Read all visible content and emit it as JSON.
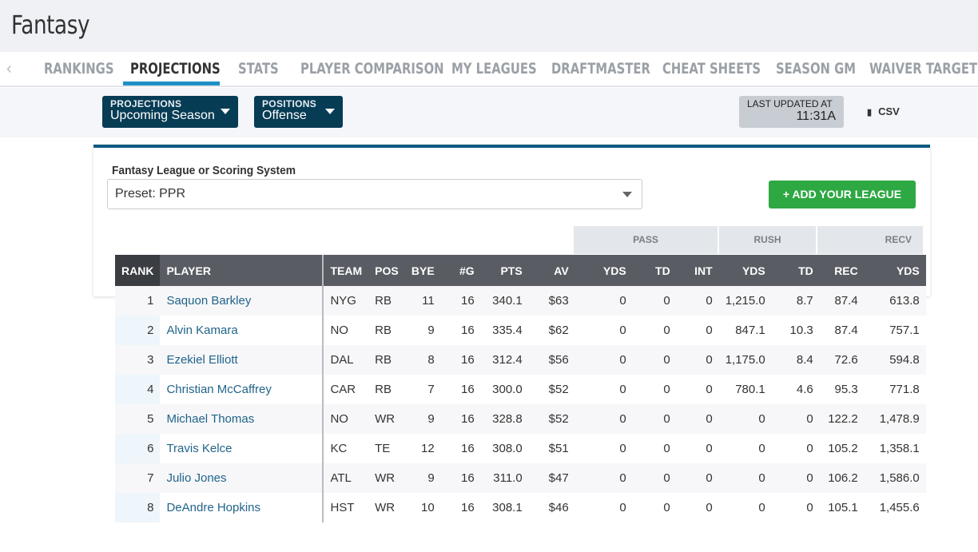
{
  "app": {
    "title": "Fantasy"
  },
  "nav": {
    "tabs": [
      "RANKINGS",
      "PROJECTIONS",
      "STATS",
      "PLAYER COMPARISON",
      "MY LEAGUES",
      "DRAFTMASTER",
      "CHEAT SHEETS",
      "SEASON GM",
      "WAIVER TARGETS"
    ],
    "active": "PROJECTIONS"
  },
  "filters": {
    "projections_label": "PROJECTIONS",
    "projections_value": "Upcoming Season",
    "positions_label": "POSITIONS",
    "positions_value": "Offense"
  },
  "updated": {
    "label": "LAST UPDATED AT",
    "time": "11:31A"
  },
  "csv_label": "CSV",
  "league": {
    "label": "Fantasy League or Scoring System",
    "value": "Preset: PPR",
    "add_label": "+ ADD YOUR LEAGUE"
  },
  "colors": {
    "accent": "#1e90c6",
    "dropdown": "#073c55",
    "add": "#2ea843",
    "header": "#595d63"
  },
  "table": {
    "groups": [
      "PASS",
      "RUSH",
      "RECV"
    ],
    "columns": [
      "RANK",
      "PLAYER",
      "TEAM",
      "POS",
      "BYE",
      "#G",
      "PTS",
      "AV",
      "YDS",
      "TD",
      "INT",
      "YDS",
      "TD",
      "REC",
      "YDS"
    ],
    "rows": [
      [
        "1",
        "Saquon Barkley",
        "NYG",
        "RB",
        "11",
        "16",
        "340.1",
        "$63",
        "0",
        "0",
        "0",
        "1,215.0",
        "8.7",
        "87.4",
        "613.8"
      ],
      [
        "2",
        "Alvin Kamara",
        "NO",
        "RB",
        "9",
        "16",
        "335.4",
        "$62",
        "0",
        "0",
        "0",
        "847.1",
        "10.3",
        "87.4",
        "757.1"
      ],
      [
        "3",
        "Ezekiel Elliott",
        "DAL",
        "RB",
        "8",
        "16",
        "312.4",
        "$56",
        "0",
        "0",
        "0",
        "1,175.0",
        "8.4",
        "72.6",
        "594.8"
      ],
      [
        "4",
        "Christian McCaffrey",
        "CAR",
        "RB",
        "7",
        "16",
        "300.0",
        "$52",
        "0",
        "0",
        "0",
        "780.1",
        "4.6",
        "95.3",
        "771.8"
      ],
      [
        "5",
        "Michael Thomas",
        "NO",
        "WR",
        "9",
        "16",
        "328.8",
        "$52",
        "0",
        "0",
        "0",
        "0",
        "0",
        "122.2",
        "1,478.9"
      ],
      [
        "6",
        "Travis Kelce",
        "KC",
        "TE",
        "12",
        "16",
        "308.0",
        "$51",
        "0",
        "0",
        "0",
        "0",
        "0",
        "105.2",
        "1,358.1"
      ],
      [
        "7",
        "Julio Jones",
        "ATL",
        "WR",
        "9",
        "16",
        "311.0",
        "$47",
        "0",
        "0",
        "0",
        "0",
        "0",
        "106.2",
        "1,586.0"
      ],
      [
        "8",
        "DeAndre Hopkins",
        "HST",
        "WR",
        "10",
        "16",
        "308.1",
        "$46",
        "0",
        "0",
        "0",
        "0",
        "0",
        "105.1",
        "1,455.6"
      ]
    ]
  }
}
